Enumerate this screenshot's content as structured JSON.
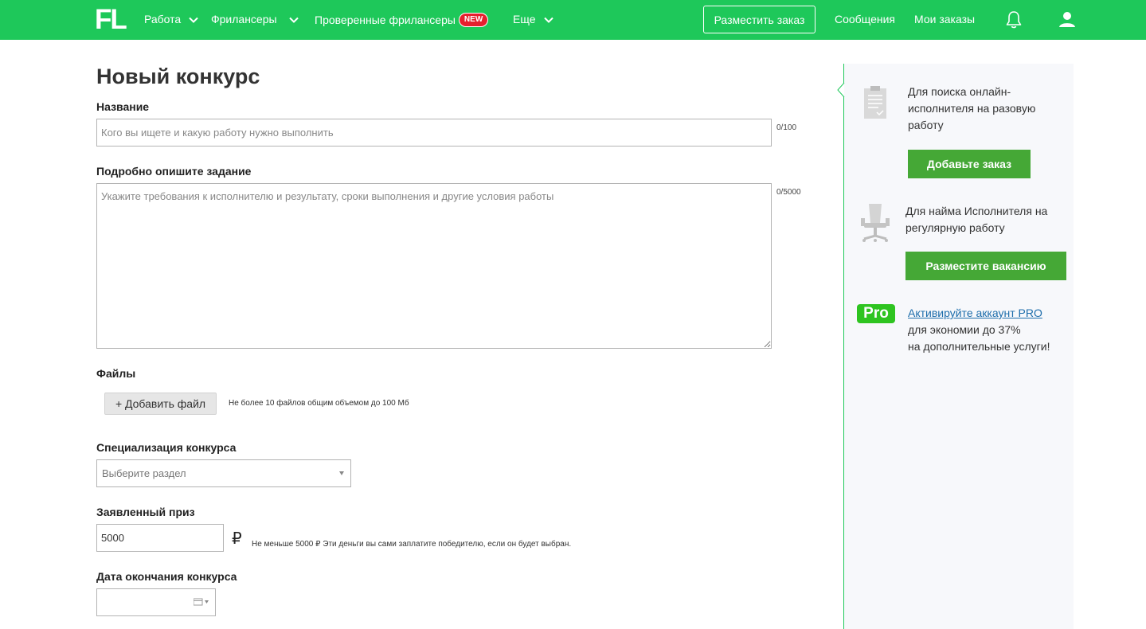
{
  "header": {
    "logo": "FL",
    "nav": [
      {
        "label": "Работа",
        "has_dropdown": true
      },
      {
        "label": "Фрилансеры",
        "has_dropdown": true
      },
      {
        "label": "Проверенные фрилансеры",
        "badge": "NEW"
      },
      {
        "label": "Еще",
        "has_dropdown": true
      }
    ],
    "post_button": "Разместить заказ",
    "messages": "Сообщения",
    "my_orders": "Мои заказы",
    "icons": [
      "bell-icon",
      "user-icon"
    ],
    "bg_color": "#1ec85a"
  },
  "form": {
    "title": "Новый конкурс",
    "name": {
      "label": "Название",
      "placeholder": "Кого вы ищете и какую работу нужно выполнить",
      "counter": "0/100"
    },
    "description": {
      "label": "Подробно опишите задание",
      "placeholder": "Укажите требования к исполнителю и результату, сроки выполнения и другие условия работы",
      "counter": "0/5000"
    },
    "files": {
      "label": "Файлы",
      "button": "+ Добавить файл",
      "hint": "Не более 10 файлов общим объемом до 100 Мб"
    },
    "specialization": {
      "label": "Специализация конкурса",
      "placeholder": "Выберите раздел"
    },
    "prize": {
      "label": "Заявленный приз",
      "value": "5000",
      "currency": "₽",
      "hint": "Не меньше 5000 ₽ Эти деньги вы сами заплатите победителю, если он будет выбран."
    },
    "end_date": {
      "label": "Дата окончания конкурса",
      "value": ""
    }
  },
  "sidebar": {
    "block1": {
      "text": "Для поиска онлайн-исполнителя на разовую работу",
      "button": "Добавьте заказ",
      "icon": "clipboard-icon"
    },
    "block2": {
      "text": "Для найма Исполнителя на регулярную работу",
      "button": "Разместите вакансию",
      "icon": "office-chair-icon"
    },
    "block3": {
      "badge": "Pro",
      "link": "Активируйте аккаунт PRO",
      "text1": "для экономии до 37%",
      "text2": "на дополнительные услуги!"
    },
    "accent": "#45a836",
    "link_color": "#1d6dab"
  }
}
